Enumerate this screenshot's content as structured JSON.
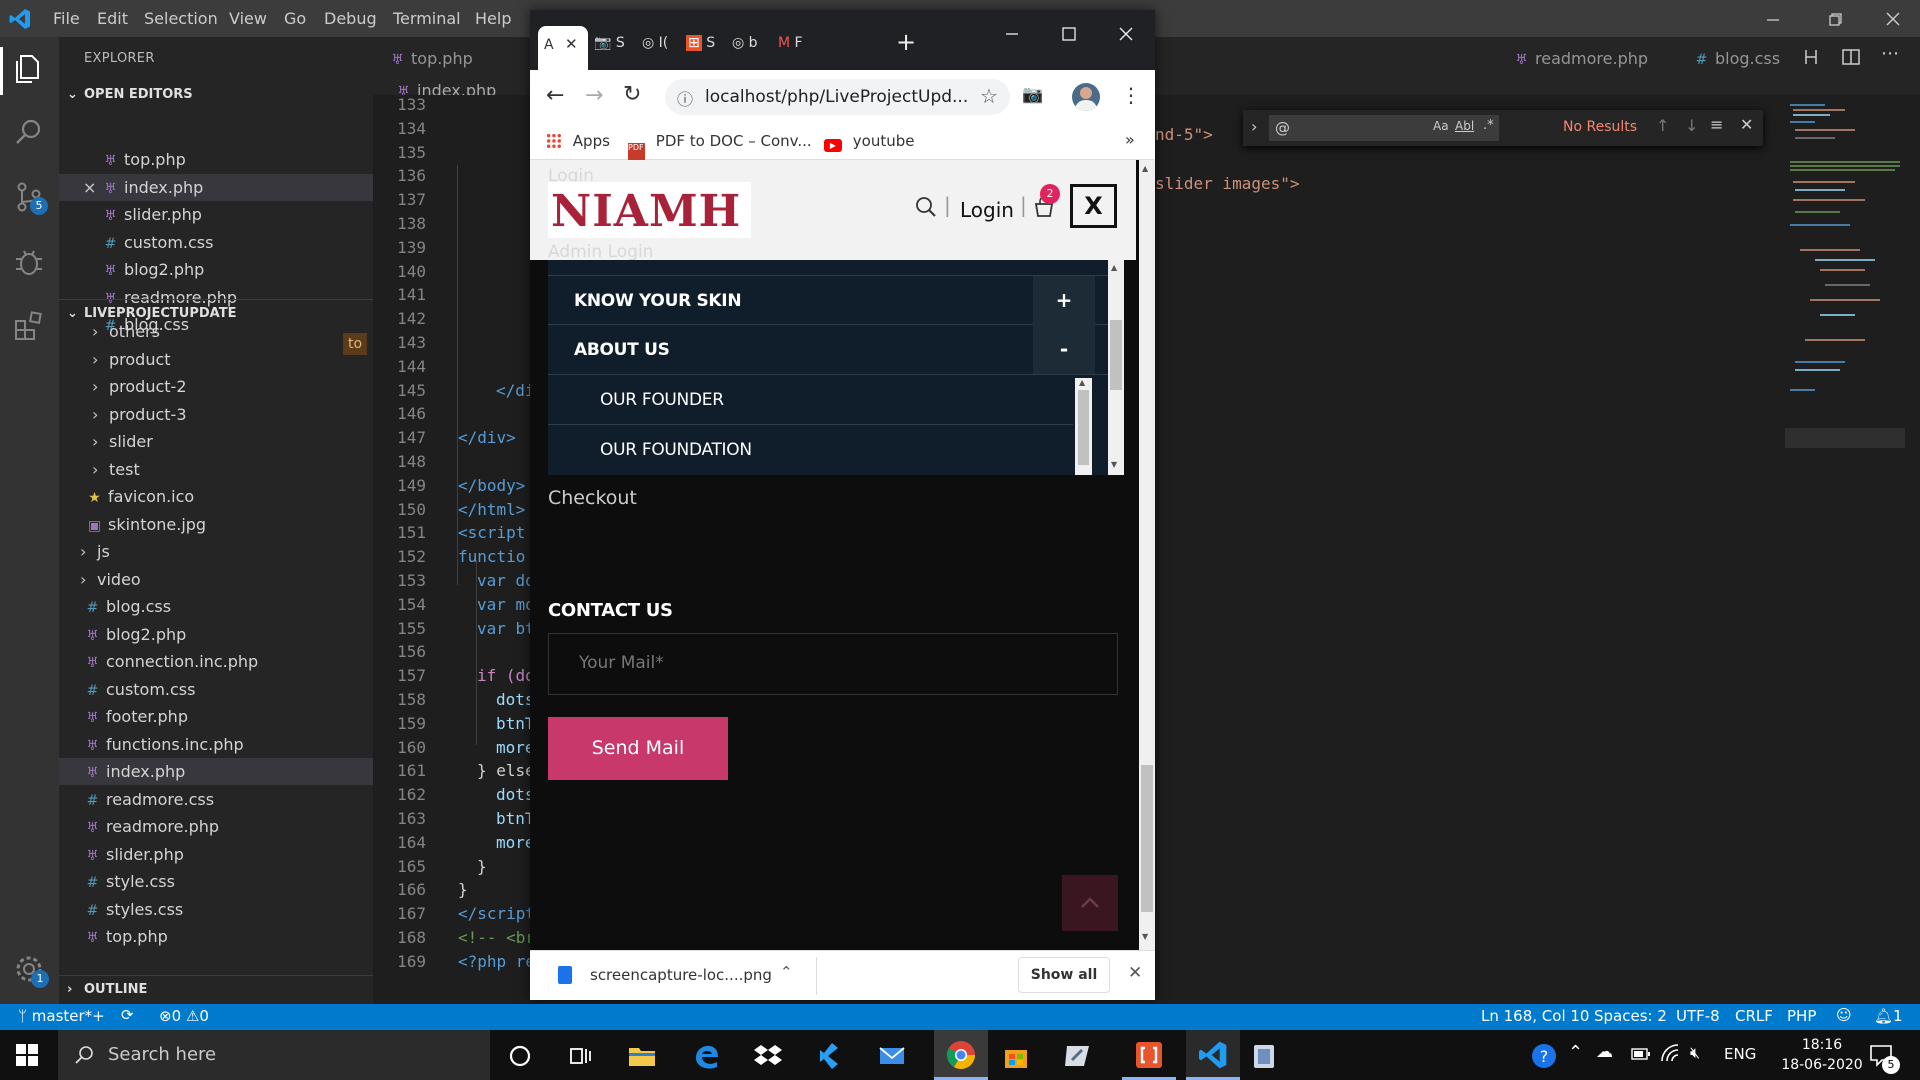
{
  "vscode": {
    "menu": [
      "File",
      "Edit",
      "Selection",
      "View",
      "Go",
      "Debug",
      "Terminal",
      "Help"
    ],
    "explorer_title": "EXPLORER",
    "open_editors_title": "OPEN EDITORS",
    "open_editors": [
      {
        "name": "top.php",
        "type": "php"
      },
      {
        "name": "index.php",
        "type": "php",
        "selected": true,
        "close": "×"
      },
      {
        "name": "slider.php",
        "type": "php"
      },
      {
        "name": "custom.css",
        "type": "css"
      },
      {
        "name": "blog2.php",
        "type": "php"
      },
      {
        "name": "readmore.php",
        "type": "php"
      },
      {
        "name": "blog.css",
        "type": "css"
      }
    ],
    "project_title": "LIVEPROJECTUPDATE",
    "project_badge": "to",
    "tree": [
      {
        "name": "others",
        "type": "folder"
      },
      {
        "name": "product",
        "type": "folder"
      },
      {
        "name": "product-2",
        "type": "folder"
      },
      {
        "name": "product-3",
        "type": "folder"
      },
      {
        "name": "slider",
        "type": "folder"
      },
      {
        "name": "test",
        "type": "folder"
      },
      {
        "name": "favicon.ico",
        "type": "star"
      },
      {
        "name": "skintone.jpg",
        "type": "image"
      },
      {
        "name": "js",
        "type": "folder-root"
      },
      {
        "name": "video",
        "type": "folder-root"
      },
      {
        "name": "blog.css",
        "type": "css"
      },
      {
        "name": "blog2.php",
        "type": "php"
      },
      {
        "name": "connection.inc.php",
        "type": "php"
      },
      {
        "name": "custom.css",
        "type": "css"
      },
      {
        "name": "footer.php",
        "type": "php"
      },
      {
        "name": "functions.inc.php",
        "type": "php"
      },
      {
        "name": "index.php",
        "type": "php",
        "selected": true
      },
      {
        "name": "readmore.css",
        "type": "css"
      },
      {
        "name": "readmore.php",
        "type": "php"
      },
      {
        "name": "slider.php",
        "type": "php"
      },
      {
        "name": "style.css",
        "type": "css"
      },
      {
        "name": "styles.css",
        "type": "css"
      },
      {
        "name": "top.php",
        "type": "php"
      }
    ],
    "outline_title": "OUTLINE",
    "source_control_badge": "5",
    "settings_badge": "1",
    "tabs": [
      {
        "name": "top.php",
        "type": "php"
      },
      {
        "name": "readmore.php",
        "type": "php"
      },
      {
        "name": "blog.css",
        "type": "css"
      }
    ],
    "breadcrumb": "index.php",
    "line_numbers": [
      133,
      134,
      135,
      136,
      137,
      138,
      139,
      140,
      141,
      142,
      143,
      144,
      145,
      146,
      147,
      148,
      149,
      150,
      151,
      152,
      153,
      154,
      155,
      156,
      157,
      158,
      159,
      160,
      161,
      162,
      163,
      164,
      165,
      166,
      167,
      168,
      169
    ],
    "code_lines": [
      {
        "line": 145,
        "text": "</div",
        "indent": 2
      },
      {
        "line": 147,
        "text": "</div>",
        "indent": 0
      },
      {
        "line": 149,
        "text": "</body>",
        "indent": 0
      },
      {
        "line": 150,
        "text": "</html>",
        "indent": 0
      },
      {
        "line": 151,
        "text": "<script",
        "indent": 0
      },
      {
        "line": 152,
        "text": "functio",
        "indent": 0
      },
      {
        "line": 153,
        "text": "var do",
        "indent": 1
      },
      {
        "line": 154,
        "text": "var mo",
        "indent": 1
      },
      {
        "line": 155,
        "text": "var bt",
        "indent": 1
      },
      {
        "line": 157,
        "text": "if (do",
        "indent": 1
      },
      {
        "line": 158,
        "text": "dots",
        "indent": 2
      },
      {
        "line": 159,
        "text": "btnT",
        "indent": 2
      },
      {
        "line": 160,
        "text": "more",
        "indent": 2
      },
      {
        "line": 161,
        "text": "} else",
        "indent": 1
      },
      {
        "line": 162,
        "text": "dots",
        "indent": 2
      },
      {
        "line": 163,
        "text": "btnT",
        "indent": 2
      },
      {
        "line": 164,
        "text": "more",
        "indent": 2
      },
      {
        "line": 165,
        "text": "}",
        "indent": 1
      },
      {
        "line": 166,
        "text": "}",
        "indent": 0
      },
      {
        "line": 167,
        "text": "</script",
        "indent": 0
      },
      {
        "line": 168,
        "text": "<!-- <br",
        "indent": 0
      },
      {
        "line": 169,
        "text": "<?php re",
        "indent": 0
      }
    ],
    "right_code": [
      "nd-5\">",
      "slider images\">"
    ],
    "find": {
      "value": "@",
      "aa": "Aa",
      "ab": "Abl",
      "regex": ".*",
      "results": "No Results"
    },
    "status": {
      "branch": "master*+",
      "errors": "0",
      "warnings": "0",
      "position": "Ln 168, Col 10",
      "spaces": "Spaces: 2",
      "encoding": "UTF-8",
      "eol": "CRLF",
      "language": "PHP",
      "notifications": "1"
    }
  },
  "browser": {
    "tabs": [
      {
        "label": "A",
        "active": true
      },
      {
        "label": "S"
      },
      {
        "label": "I("
      },
      {
        "label": "S"
      },
      {
        "label": "b"
      },
      {
        "label": "F"
      }
    ],
    "url": "localhost/php/LiveProjectUpd...",
    "bookmarks": [
      "Apps",
      "PDF to DOC – Conv...",
      "youtube"
    ],
    "page": {
      "faded_login": "Login",
      "logo": "NIAMH",
      "login": "Login",
      "cart_count": "2",
      "close": "X",
      "faded_admin": "Admin Login",
      "menu": [
        {
          "label": "KNOW YOUR SKIN",
          "toggle": "+"
        },
        {
          "label": "ABOUT US",
          "toggle": "-"
        }
      ],
      "submenu": [
        "OUR FOUNDER",
        "OUR FOUNDATION"
      ],
      "checkout": "Checkout",
      "contact_title": "CONTACT US",
      "mail_placeholder": "Your Mail*",
      "send_button": "Send Mail"
    },
    "download": {
      "file": "screencapture-loc....png",
      "show_all": "Show all"
    }
  },
  "taskbar": {
    "search_placeholder": "Search here",
    "language": "ENG",
    "time": "18:16",
    "date": "18-06-2020",
    "notification_count": "5"
  }
}
